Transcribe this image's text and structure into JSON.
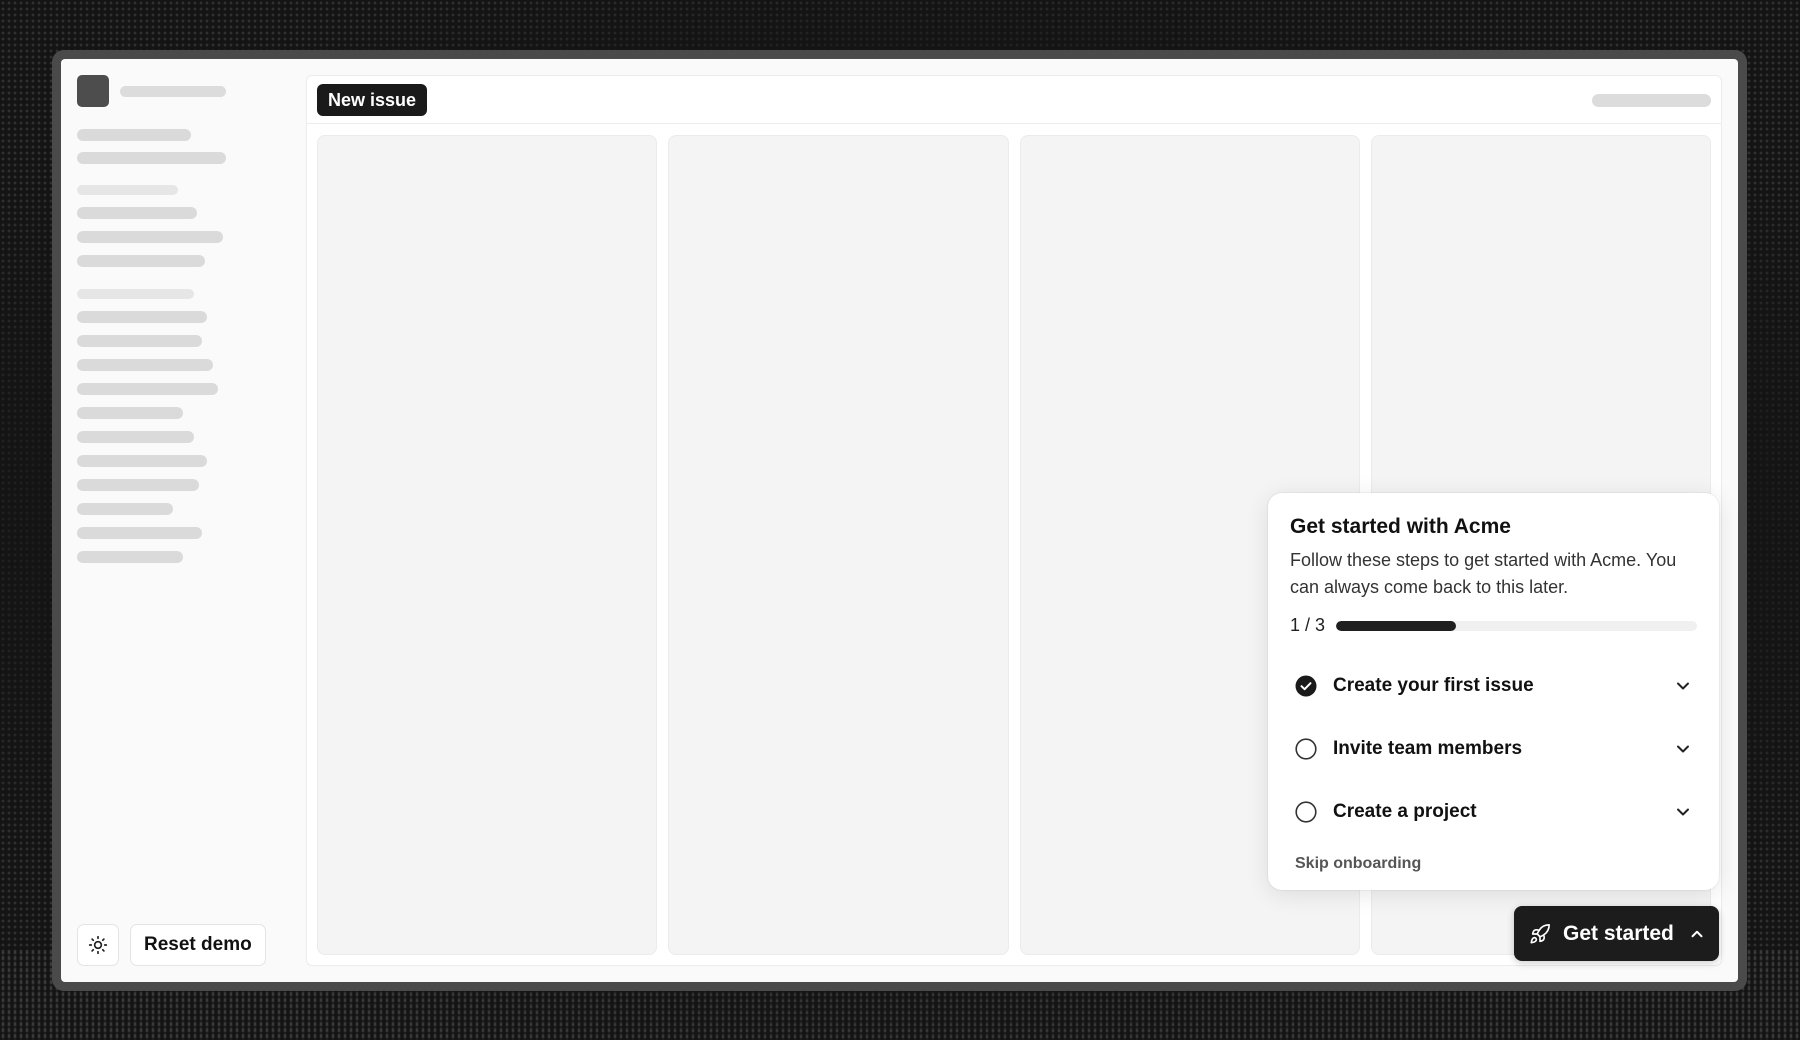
{
  "header": {
    "new_issue_label": "New issue"
  },
  "sidebar": {
    "reset_label": "Reset demo",
    "theme_icon": "sun-icon"
  },
  "board": {
    "column_count": 4
  },
  "onboarding": {
    "title": "Get started with Acme",
    "description": "Follow these steps to get started with Acme. You can always come back to this later.",
    "progress_label": "1 / 3",
    "progress_fraction": 0.333,
    "steps": [
      {
        "label": "Create your first issue",
        "completed": true
      },
      {
        "label": "Invite team members",
        "completed": false
      },
      {
        "label": "Create a project",
        "completed": false
      }
    ],
    "skip_label": "Skip onboarding"
  },
  "launcher": {
    "label": "Get started",
    "icon": "rocket-icon"
  },
  "colors": {
    "accent": "#1c1c1c",
    "background": "#141414",
    "column_fill": "#f4f4f4"
  }
}
